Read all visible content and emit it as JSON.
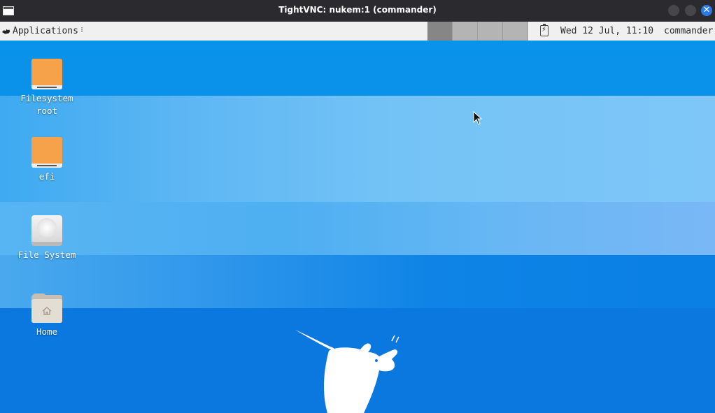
{
  "window": {
    "title": "TightVNC: nukem:1 (commander)",
    "close_glyph": "✕"
  },
  "panel": {
    "applications_label": "Applications",
    "handle_glyph": "⠇",
    "workspaces": [
      {
        "name": "workspace-1",
        "active": true
      },
      {
        "name": "workspace-2",
        "active": false
      },
      {
        "name": "workspace-3",
        "active": false
      },
      {
        "name": "workspace-4",
        "active": false
      }
    ],
    "battery_glyph": "⚡",
    "clock": "Wed 12 Jul, 11:10",
    "user": "commander"
  },
  "desktop": {
    "icons": [
      {
        "icon": "drive-icon",
        "label_line1": "Filesystem",
        "label_line2": "root"
      },
      {
        "icon": "drive-icon",
        "label_line1": "efi",
        "label_line2": ""
      },
      {
        "icon": "harddisk-icon",
        "label_line1": "File System",
        "label_line2": ""
      },
      {
        "icon": "home-folder-icon",
        "label_line1": "Home",
        "label_line2": ""
      }
    ]
  },
  "colors": {
    "titlebar": "#2b2b2f",
    "panel": "#f0f0f0",
    "desktop_blue": "#0a84e6",
    "close_button": "#2a7be5",
    "drive_orange": "#f6a24a"
  }
}
